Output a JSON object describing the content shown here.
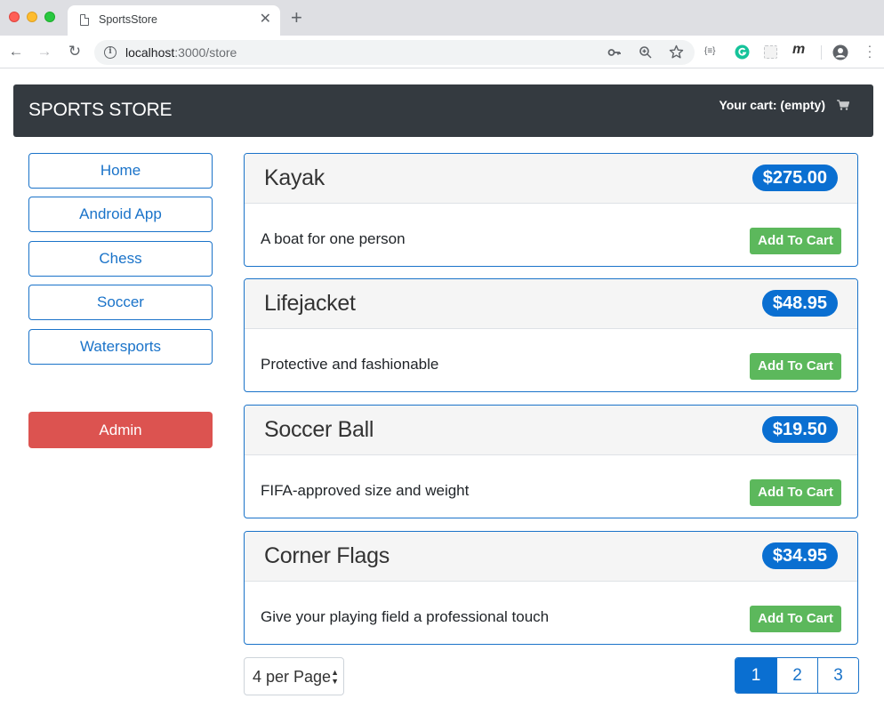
{
  "browser": {
    "tab_title": "SportsStore",
    "url_host": "localhost",
    "url_rest": ":3000/store"
  },
  "navbar": {
    "brand": "SPORTS STORE",
    "cart_text": "Your cart: (empty)"
  },
  "categories": [
    "Home",
    "Android App",
    "Chess",
    "Soccer",
    "Watersports"
  ],
  "admin_label": "Admin",
  "products": [
    {
      "name": "Kayak",
      "price": "$275.00",
      "description": "A boat for one person",
      "button": "Add To Cart"
    },
    {
      "name": "Lifejacket",
      "price": "$48.95",
      "description": "Protective and fashionable",
      "button": "Add To Cart"
    },
    {
      "name": "Soccer Ball",
      "price": "$19.50",
      "description": "FIFA-approved size and weight",
      "button": "Add To Cart"
    },
    {
      "name": "Corner Flags",
      "price": "$34.95",
      "description": "Give your playing field a professional touch",
      "button": "Add To Cart"
    }
  ],
  "pagination": {
    "per_page": "4 per Page",
    "pages": [
      "1",
      "2",
      "3"
    ],
    "active_page": "1"
  },
  "colors": {
    "primary": "#0a6fd1",
    "navbar": "#343a40",
    "danger": "#dc5350",
    "success": "#5cb85c"
  }
}
